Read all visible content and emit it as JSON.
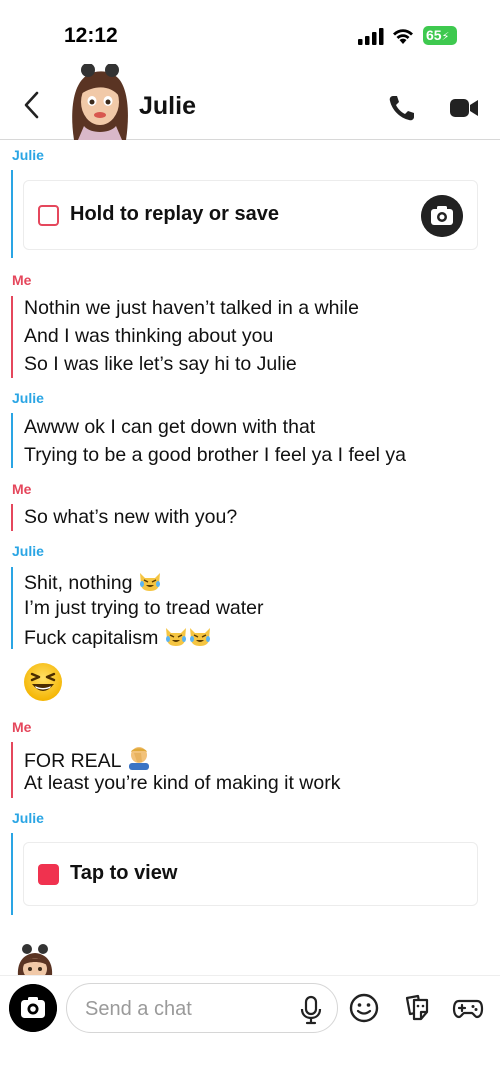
{
  "status_bar": {
    "time": "12:12",
    "battery": "65"
  },
  "header": {
    "contact_name": "Julie"
  },
  "messages": {
    "m1": {
      "sender": "Julie",
      "media_label": "Hold to replay or save"
    },
    "m2": {
      "sender": "Me",
      "lines": [
        "Nothin we just haven’t talked in a while",
        "And I was thinking about you",
        "So I was like let’s say hi to Julie"
      ]
    },
    "m3": {
      "sender": "Julie",
      "lines": [
        "Awww ok I can get down with that",
        "Trying to be a good brother I feel ya I feel ya"
      ]
    },
    "m4": {
      "sender": "Me",
      "lines": [
        "So what’s new with you?"
      ]
    },
    "m5": {
      "sender": "Julie",
      "lines": [
        "Shit, nothing",
        "I’m just trying to tread water",
        "Fuck capitalism"
      ]
    },
    "m6": {
      "sender": "Me",
      "lines": [
        "FOR REAL",
        "At least you’re kind of making it work"
      ]
    },
    "m7": {
      "sender": "Julie",
      "media_label": "Tap to view"
    }
  },
  "composer": {
    "placeholder": "Send a chat"
  },
  "colors": {
    "julie": "#2aa5e4",
    "me": "#e5475c",
    "snap_red": "#f0324f"
  },
  "icons": [
    "back-chevron",
    "phone",
    "video-camera",
    "camera",
    "microphone",
    "smiley",
    "sticker",
    "game-controller"
  ]
}
